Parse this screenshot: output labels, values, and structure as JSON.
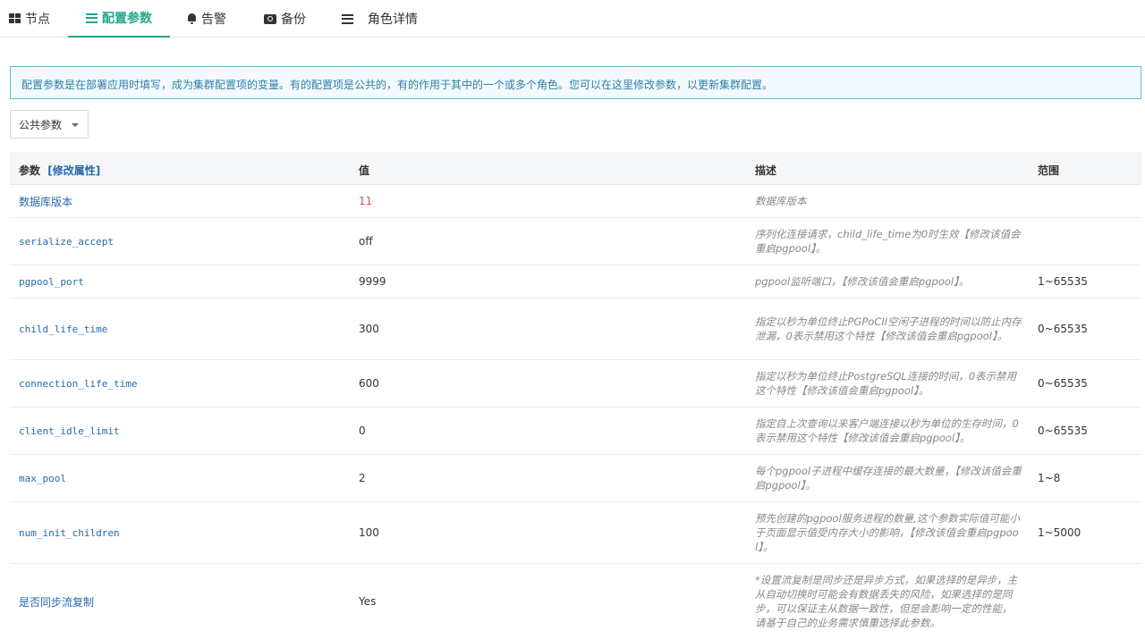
{
  "tabs": [
    {
      "label": "节点",
      "icon": "grid-icon"
    },
    {
      "label": "配置参数",
      "icon": "list-icon",
      "active": true
    },
    {
      "label": "告警",
      "icon": "bell-icon"
    },
    {
      "label": "备份",
      "icon": "camera-icon"
    },
    {
      "label": "角色详情",
      "icon": "list-icon"
    }
  ],
  "info": "配置参数是在部署应用时填写，成为集群配置项的变量。有的配置项是公共的，有的作用于其中的一个或多个角色。您可以在这里修改参数，以更新集群配置。",
  "dropdown": {
    "value": "公共参数"
  },
  "table": {
    "headers": {
      "param": "参数",
      "edit": "[修改属性]",
      "value": "值",
      "desc": "描述",
      "range": "范围"
    },
    "rows": [
      {
        "param": "数据库版本",
        "value": "11",
        "desc": "数据库版本",
        "range": ""
      },
      {
        "param": "serialize_accept",
        "value": "off",
        "desc": "序列化连接请求，child_life_time为0时生效【修改该值会重启pgpool】。",
        "range": ""
      },
      {
        "param": "pgpool_port",
        "value": "9999",
        "desc": "pgpool监听端口，【修改该值会重启pgpool】。",
        "range": "1~65535"
      },
      {
        "param": "child_life_time",
        "value": "300",
        "desc": "指定以秒为单位终止PGPoCII空闲子进程的时间以防止内存泄漏，0表示禁用这个特性【修改该值会重启pgpool】。",
        "range": "0~65535"
      },
      {
        "param": "connection_life_time",
        "value": "600",
        "desc": "指定以秒为单位终止PostgreSQL连接的时间，0表示禁用这个特性【修改该值会重启pgpool】。",
        "range": "0~65535"
      },
      {
        "param": "client_idle_limit",
        "value": "0",
        "desc": "指定自上次查询以来客户端连接以秒为单位的生存时间，0表示禁用这个特性【修改该值会重启pgpool】。",
        "range": "0~65535"
      },
      {
        "param": "max_pool",
        "value": "2",
        "desc": "每个pgpool子进程中缓存连接的最大数量，【修改该值会重启pgpool】。",
        "range": "1~8"
      },
      {
        "param": "num_init_children",
        "value": "100",
        "desc": "预先创建的pgpool服务进程的数量,这个参数实际值可能小于页面显示值受内存大小的影响，【修改该值会重启pgpool】。",
        "range": "1~5000"
      },
      {
        "param": "是否同步流复制",
        "value": "Yes",
        "desc": "*设置流复制是同步还是异步方式，如果选择的是异步，主从自动切换时可能会有数据丢失的风险，如果选择的是同步，可以保证主从数据一致性，但是会影响一定的性能，请基于自己的业务需求慎重选择此参数。",
        "range": ""
      }
    ]
  },
  "colors": {
    "accent": "#23a68a",
    "link": "#2668b0",
    "info_border": "#5dbfd0",
    "info_text": "#2f7ea7",
    "version_value": "#d9534f"
  }
}
